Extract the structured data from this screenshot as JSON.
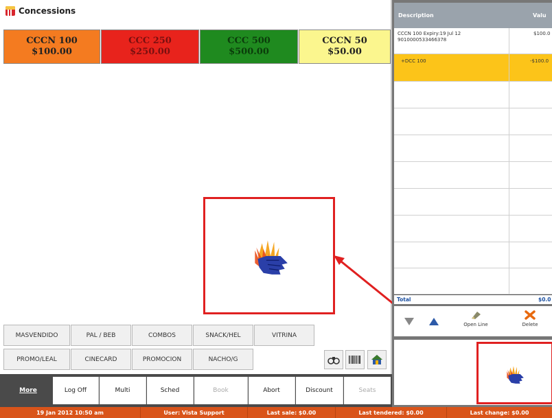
{
  "header": {
    "title": "Concessions",
    "icon": "popcorn-icon"
  },
  "items": [
    {
      "line1": "CCCN 100",
      "line2": "$100.00",
      "bg": "#f47b20",
      "fg": "#222222"
    },
    {
      "line1": "CCC 250",
      "line2": "$250.00",
      "bg": "#e8231c",
      "fg": "#7a1010"
    },
    {
      "line1": "CCC 500",
      "line2": "$500.00",
      "bg": "#1f8a1f",
      "fg": "#0b3d0b"
    },
    {
      "line1": "CCCN 50",
      "line2": "$50.00",
      "bg": "#fbf68e",
      "fg": "#222222"
    }
  ],
  "categories_row1": [
    "MASVENDIDO",
    "PAL / BEB",
    "COMBOS",
    "SNACK/HEL",
    "VITRINA"
  ],
  "categories_row2": [
    "PROMO/LEAL",
    "CINECARD",
    "PROMOCION",
    "NACHO/G"
  ],
  "nav": {
    "more": "More",
    "buttons": [
      "Log Off",
      "Multi",
      "Sched",
      "Book",
      "Abort",
      "Discount",
      "Seats"
    ],
    "disabled": [
      "Book",
      "Seats"
    ]
  },
  "order": {
    "col_description": "Description",
    "col_value": "Valu",
    "rows": [
      {
        "description": "CCCN 100  Expiry:19 Jul 12",
        "detail": "9010000533466378",
        "value": "$100.0"
      },
      {
        "description": "+DCC 100",
        "detail": "",
        "value": "-$100.0"
      }
    ],
    "total_label": "Total",
    "total_value": "$0.0",
    "actions": {
      "open_line": "Open Line",
      "delete": "Delete"
    }
  },
  "status": {
    "datetime": "19 Jan 2012 10:50 am",
    "user": "User: Vista Support",
    "last_sale": "Last sale: $0.00",
    "last_tendered": "Last tendered: $0.00",
    "last_change": "Last change: $0.00"
  },
  "colors": {
    "accent": "#d9541a",
    "highlight_row": "#fcc419",
    "annotation": "#e02020",
    "header_bg": "#9aa3ac",
    "total_text": "#1a4fa0"
  }
}
